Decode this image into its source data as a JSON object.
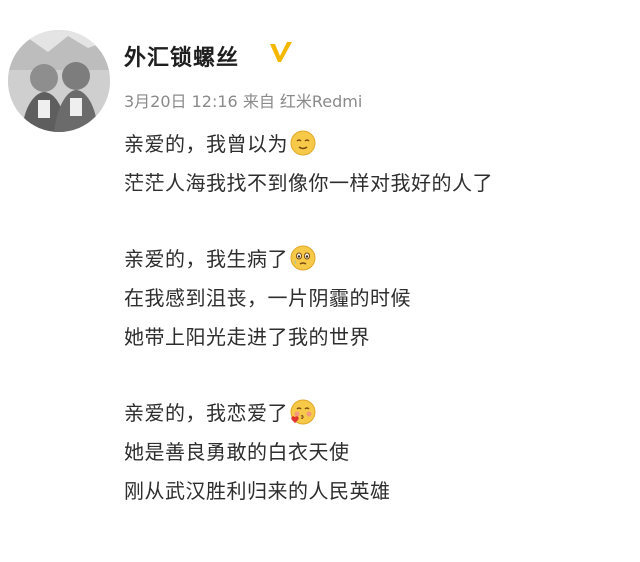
{
  "post": {
    "username": "外汇锁螺丝",
    "verified_icon": "verified-v-badge",
    "meta": "3月20日 12:16 来自 红米Redmi",
    "paragraphs": [
      {
        "lines": [
          {
            "text": "亲爱的，我曾以为",
            "emoji": "sweat-smile-emoji"
          },
          {
            "text": "茫茫人海我找不到像你一样对我好的人了"
          }
        ]
      },
      {
        "lines": [
          {
            "text": "亲爱的，我生病了",
            "emoji": "teary-emoji"
          },
          {
            "text": "在我感到沮丧，一片阴霾的时候"
          },
          {
            "text": "她带上阳光走进了我的世界"
          }
        ]
      },
      {
        "lines": [
          {
            "text": "亲爱的，我恋爱了",
            "emoji": "kiss-emoji"
          },
          {
            "text": "她是善良勇敢的白衣天使"
          },
          {
            "text": "刚从武汉胜利归来的人民英雄"
          }
        ]
      }
    ]
  },
  "colors": {
    "username": "#1f1f1f",
    "meta": "#8a8a8a",
    "body_text": "#2e2e2e",
    "verified": "#f5b800",
    "emoji_face": "#f7c948"
  }
}
